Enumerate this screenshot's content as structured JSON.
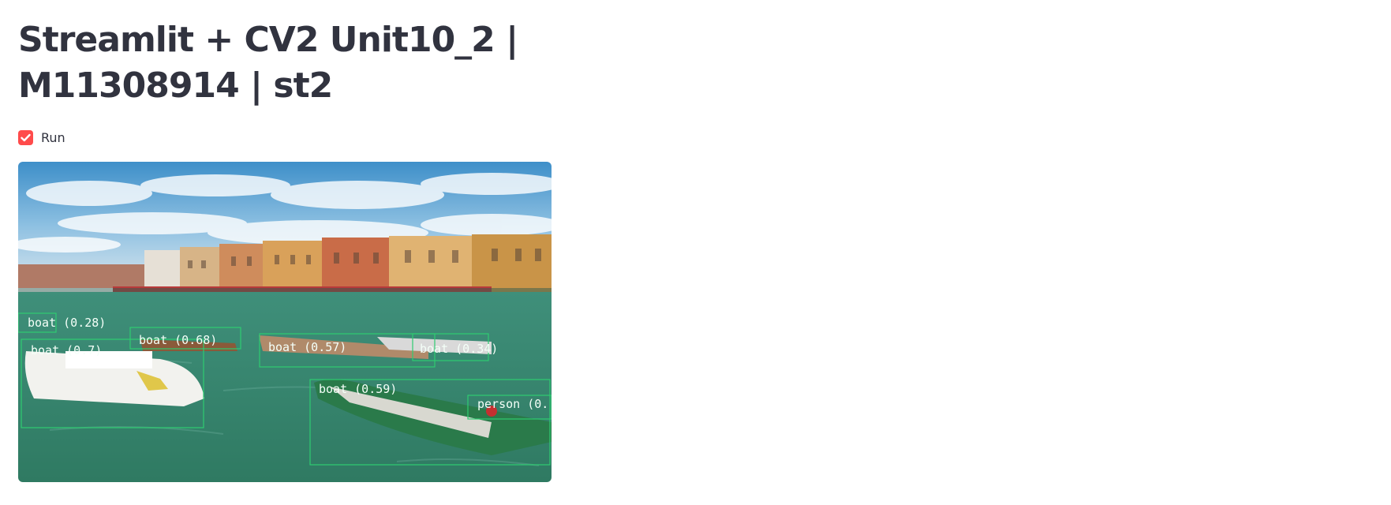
{
  "page": {
    "title": "Streamlit + CV2 Unit10_2 | M11308914 | st2"
  },
  "run_checkbox": {
    "label": "Run",
    "checked": true,
    "accent_color": "#ff4b4b"
  },
  "video": {
    "box_color": "#2ecc71",
    "detections": [
      {
        "label": "boat (0.28)"
      },
      {
        "label": "boat (0.68)"
      },
      {
        "label": "boat (0.7)"
      },
      {
        "label": "boat (0.57)"
      },
      {
        "label": "boat (0.34)"
      },
      {
        "label": "boat (0.59)"
      },
      {
        "label": "person (0."
      }
    ]
  }
}
